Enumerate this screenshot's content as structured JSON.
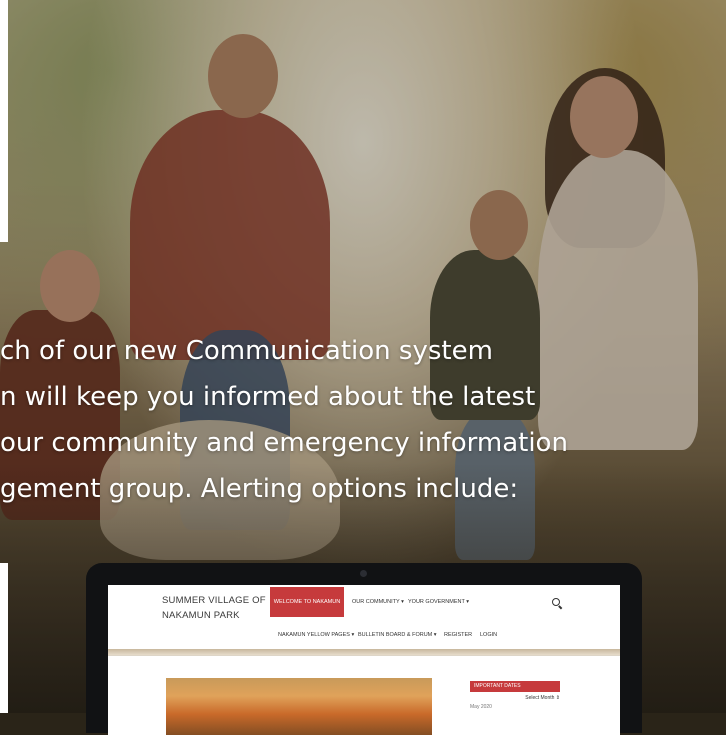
{
  "intro": {
    "lines": [
      "ch of our new Communication system",
      "n will keep you informed about the latest",
      "our community and emergency information",
      "gement group. Alerting options include:"
    ]
  },
  "website": {
    "title_line1": "SUMMER VILLAGE OF",
    "title_line2": "NAKAMUN PARK",
    "nav": {
      "welcome": "WELCOME TO NAKAMUN",
      "community": "OUR COMMUNITY ▾",
      "government": "YOUR GOVERNMENT ▾"
    },
    "subnav": {
      "yellow_pages": "NAKAMUN YELLOW PAGES ▾",
      "bulletin": "BULLETIN BOARD & FORUM ▾",
      "register": "REGISTER",
      "login": "LOGIN"
    },
    "important_dates": {
      "heading": "IMPORTANT DATES",
      "select": "Select Month ⇕",
      "month": "May 2020"
    },
    "colors": {
      "accent": "#c63a3c"
    }
  }
}
